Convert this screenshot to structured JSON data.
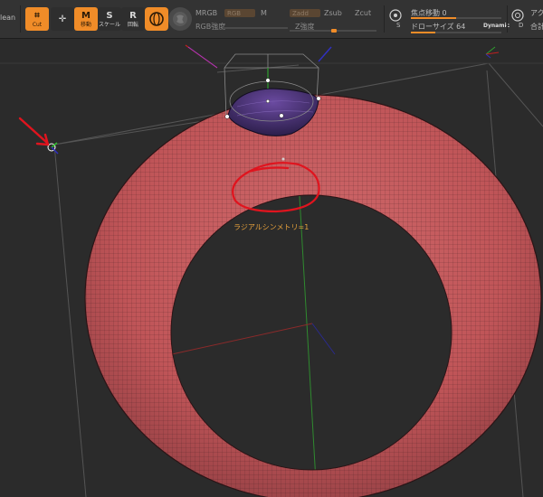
{
  "toolbar": {
    "clean_label": "lean",
    "cut_label": "Cut",
    "move_label": "移動",
    "scale_label": "スケール",
    "rotate_label": "回転",
    "mrgb_label": "MRGB",
    "rgb_label": "RGB",
    "m_label": "M",
    "rgb_intensity_label": "RGB強度",
    "zadd_label": "Zadd",
    "zsub_label": "Zsub",
    "zcut_label": "Zcut",
    "z_intensity_label": "Z強度",
    "focal_shift_label": "焦点移動 0",
    "draw_size_label": "ドローサイズ 64",
    "dynamic_label": "Dynamic",
    "s_key": "S",
    "d_key": "D",
    "right_top_label": "アク",
    "right_bottom_label": "合計",
    "focal_shift_fraction": 0.5,
    "draw_size_fraction": 0.27
  },
  "annotation": {
    "text": "ラジアルシンメトリ=1"
  },
  "colors": {
    "accent": "#f08c28",
    "annotation_red": "#e0141e",
    "torus": "#c4585c",
    "background": "#2b2b2b"
  }
}
